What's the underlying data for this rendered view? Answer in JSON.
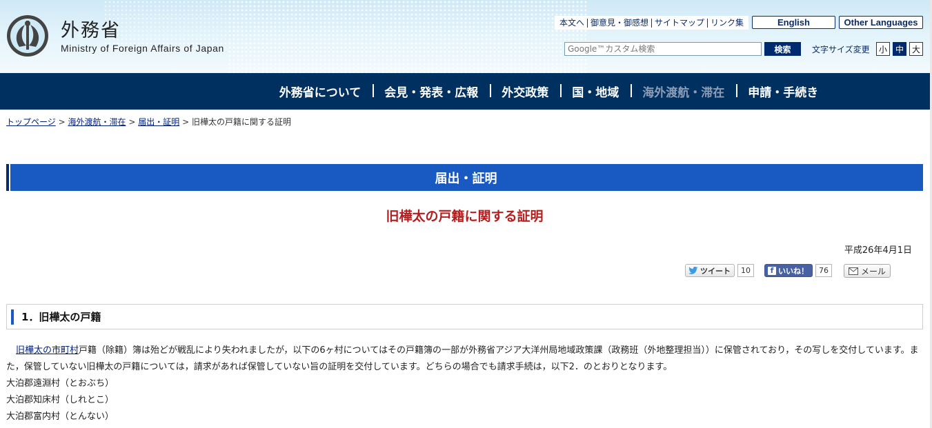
{
  "header": {
    "site_name_ja": "外務省",
    "site_name_en": "Ministry of Foreign Affairs of Japan",
    "util_links": [
      "本文へ",
      "御意見・御感想",
      "サイトマップ",
      "リンク集"
    ],
    "english": "English",
    "other_languages": "Other Languages",
    "search_placeholder": "Google™カスタム検索",
    "search_button": "検索",
    "font_size_label": "文字サイズ変更",
    "font_sizes": [
      "小",
      "中",
      "大"
    ]
  },
  "nav": {
    "items": [
      "外務省について",
      "会見・発表・広報",
      "外交政策",
      "国・地域",
      "海外渡航・滞在",
      "申請・手続き"
    ]
  },
  "breadcrumb": {
    "items": [
      "トップページ",
      "海外渡航・滞在",
      "届出・証明"
    ],
    "current": "旧樺太の戸籍に関する証明",
    "separator": ">"
  },
  "section_title": "届出・証明",
  "page_title": "旧樺太の戸籍に関する証明",
  "date": "平成26年4月1日",
  "social": {
    "tweet_label": "ツイート",
    "tweet_count": "10",
    "like_label": "いいね！",
    "like_count": "76",
    "mail_label": "メール"
  },
  "content": {
    "heading": "1．旧樺太の戸籍",
    "link_text": "旧樺太の市町村",
    "paragraph": "戸籍（除籍）簿は殆どが戦乱により失われましたが，以下の6ヶ村についてはその戸籍簿の一部が外務省アジア大洋州局地域政策課（政務班（外地整理担当））に保管されており，その写しを交付しています。また，保管していない旧樺太の戸籍については，請求があれば保管していない旨の証明を交付しています。どちらの場合でも請求手続は，以下2．のとおりとなります。",
    "villages": [
      "大泊郡遠淵村（とおぶち）",
      "大泊郡知床村（しれとこ）",
      "大泊郡富内村（とんない）"
    ]
  },
  "colors": {
    "nav_bg": "#003060",
    "section_bar": "#1959c2",
    "title_red": "#b51e1e"
  }
}
